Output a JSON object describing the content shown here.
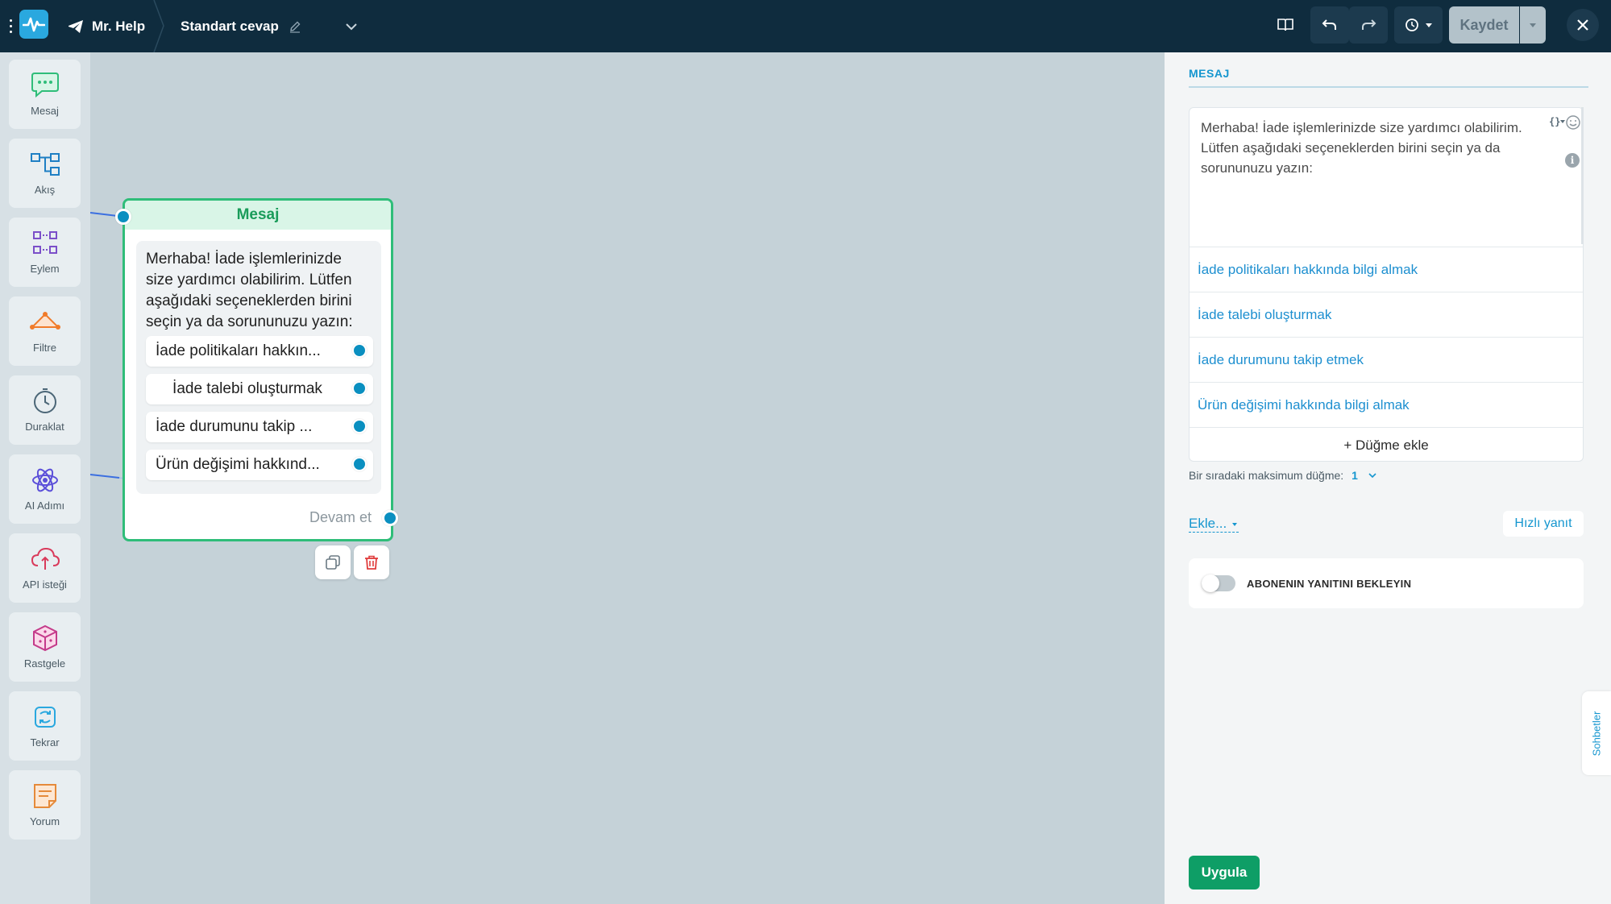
{
  "topbar": {
    "bot_name": "Mr. Help",
    "flow_name": "Standart cevap",
    "save_label": "Kaydet"
  },
  "toolbar": {
    "items": [
      {
        "label": "Mesaj",
        "icon": "chat-bubble-icon",
        "color": "#2fbd79"
      },
      {
        "label": "Akış",
        "icon": "flow-icon",
        "color": "#1e7fc4"
      },
      {
        "label": "Eylem",
        "icon": "action-icon",
        "color": "#7b4fc9"
      },
      {
        "label": "Filtre",
        "icon": "filter-icon",
        "color": "#f07b2a"
      },
      {
        "label": "Duraklat",
        "icon": "clock-icon",
        "color": "#4b6677"
      },
      {
        "label": "AI Adımı",
        "icon": "ai-atom-icon",
        "color": "#5b4fd9"
      },
      {
        "label": "API isteği",
        "icon": "cloud-api-icon",
        "color": "#d93a5b"
      },
      {
        "label": "Rastgele",
        "icon": "cube-icon",
        "color": "#c43a8a"
      },
      {
        "label": "Tekrar",
        "icon": "repeat-icon",
        "color": "#2aa8df"
      },
      {
        "label": "Yorum",
        "icon": "note-icon",
        "color": "#e58a3a"
      }
    ]
  },
  "node": {
    "title": "Mesaj",
    "text": "Merhaba! İade işlemlerinizde size yardımcı olabilirim. Lütfen aşağıdaki seçeneklerden birini seçin ya da sorununuzu yazın:",
    "buttons": [
      "İade politikaları hakkın...",
      "İade talebi oluşturmak",
      "İade durumunu takip ...",
      "Ürün değişimi hakkınd..."
    ],
    "continue_label": "Devam et"
  },
  "panel": {
    "title": "MESAJ",
    "message": "Merhaba! İade işlemlerinizde size yardımcı olabilirim. Lütfen aşağıdaki seçeneklerden birini seçin ya da sorununuzu yazın:",
    "options": [
      "İade politikaları hakkında bilgi almak",
      "İade talebi oluşturmak",
      "İade durumunu takip etmek",
      "Ürün değişimi hakkında bilgi almak"
    ],
    "add_button": "+ Düğme ekle",
    "max_label": "Bir sıradaki maksimum düğme:",
    "max_value": "1",
    "add_menu": "Ekle...",
    "quick_reply": "Hızlı yanıt",
    "wait_label": "ABONENIN YANITINI BEKLEYIN",
    "apply_label": "Uygula",
    "chats_tab": "Sohbetler"
  }
}
